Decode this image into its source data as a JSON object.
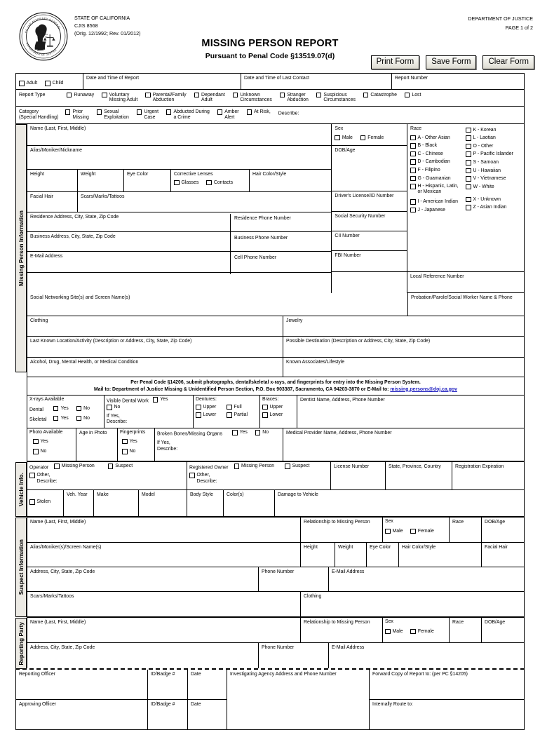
{
  "header": {
    "state": "STATE OF CALIFORNIA",
    "form_no": "CJIS 8568",
    "revision": "(Orig. 12/1992; Rev. 01/2012)",
    "department": "DEPARTMENT OF JUSTICE",
    "page": "PAGE 1 of 2",
    "title": "MISSING PERSON REPORT",
    "subtitle": "Pursuant to Penal Code §13519.07(d)",
    "buttons": {
      "print": "Print Form",
      "save": "Save Form",
      "clear": "Clear Form"
    }
  },
  "top": {
    "adult": "Adult",
    "child": "Child",
    "date_report": "Date and Time of Report",
    "date_last_contact": "Date and Time of Last Contact",
    "report_number": "Report Number",
    "report_type_label": "Report Type",
    "report_types": [
      "Runaway",
      "Voluntary\nMissing Adult",
      "Parental/Family\nAbduction",
      "Dependant\nAdult",
      "Unknown\nCircumstances",
      "Stranger\nAbduction",
      "Suspicious\nCircumstances",
      "Catastrophe",
      "Lost"
    ],
    "category_label": "Category\n(Special Handling)",
    "categories": [
      "Prior\nMissing",
      "Sexual\nExploitation",
      "Urgent\nCase",
      "Abducted During\na Crime",
      "Amber\nAlert"
    ],
    "at_risk": "At Risk,",
    "describe": "Describe:"
  },
  "missing": {
    "section_label": "Missing Person Information",
    "name": "Name (Last, First, Middle)",
    "sex": "Sex",
    "male": "Male",
    "female": "Female",
    "race_label": "Race",
    "alias": "Alias/Moniker/Nickname",
    "dob_age": "DOB/Age",
    "height": "Height",
    "weight": "Weight",
    "eye_color": "Eye Color",
    "corrective_lenses": "Corrective Lenses",
    "glasses": "Glasses",
    "contacts": "Contacts",
    "hair_color_style": "Hair Color/Style",
    "facial_hair": "Facial Hair",
    "scars": "Scars/Marks/Tattoos",
    "dl_number": "Driver's License/ID Number",
    "residence_address": "Residence Address, City, State, Zip Code",
    "residence_phone": "Residence Phone Number",
    "ssn": "Social Security Number",
    "business_address": "Business Address, City, State, Zip Code",
    "business_phone": "Business Phone Number",
    "cii_number": "CII Number",
    "email": "E-Mail Address",
    "cell_phone": "Cell Phone Number",
    "fbi_number": "FBI Number",
    "local_reference": "Local Reference Number",
    "social_networking": "Social Networking Site(s) and Screen Name(s)",
    "probation": "Probation/Parole/Social Worker Name & Phone",
    "clothing": "Clothing",
    "jewelry": "Jewelry",
    "last_known": "Last Known Location/Activity (Description or Address, City, State, Zip Code)",
    "possible_destination": "Possible Destination (Description or Address, City, State, Zip Code)",
    "alcohol": "Alcohol, Drug, Mental Health, or Medical Condition",
    "known_associates": "Known Associates/Lifestyle",
    "races_left": [
      "A - Other Asian",
      "B - Black",
      "C - Chinese",
      "D - Cambodian",
      "F - Filipino",
      "G - Guamanian",
      "H - Hispanic, Latin,\nor Mexican",
      "I - American Indian",
      "J - Japanese"
    ],
    "races_right": [
      "K - Korean",
      "L - Laotian",
      "O - Other",
      "P - Pacific Islander",
      "S - Samoan",
      "U - Hawaiian",
      "V - Vietnamese",
      "W - White",
      "X - Unknown",
      "Z - Asian Indian"
    ]
  },
  "notice": {
    "line1": "Per Penal Code §14206, submit photographs, dental/skeletal x-rays, and fingerprints for entry into the Missing Person System.",
    "line2_a": "Mail to: Department of Justice Missing & Unidentified Person Section, P.O. Box 903387, Sacramento, CA  94203-3870 or E-Mail to: ",
    "line2_email": "missing.persons@doj.ca.gov"
  },
  "dental": {
    "xrays_available": "X-rays Available",
    "dental": "Dental",
    "skeletal": "Skeletal",
    "yes": "Yes",
    "no": "No",
    "visible_dental_work": "Visible Dental Work",
    "if_yes_describe": "If Yes,\nDescribe:",
    "dentures": "Dentures:",
    "upper": "Upper",
    "lower": "Lower",
    "full": "Full",
    "partial": "Partial",
    "braces": "Braces:",
    "dentist": "Dentist Name, Address, Phone Number",
    "photo_available": "Photo Available",
    "age_in_photo": "Age in Photo",
    "fingerprints": "Fingerprints",
    "broken_bones": "Broken Bones/Missing Organs",
    "medical_provider": "Medical Provider Name, Address, Phone Number"
  },
  "vehicle": {
    "section_label": "Vehicle Info.",
    "operator": "Operator",
    "missing_person": "Missing Person",
    "suspect": "Suspect",
    "other_describe": "Other,\nDescribe:",
    "registered_owner": "Registered Owner",
    "license_number": "License Number",
    "state_province": "State, Province, Country",
    "registration_expiration": "Registration Expiration",
    "stolen": "Stolen",
    "veh_year": "Veh. Year",
    "make": "Make",
    "model": "Model",
    "body_style": "Body Style",
    "colors": "Color(s)",
    "damage": "Damage to Vehicle"
  },
  "suspect": {
    "section_label": "Suspect Information",
    "name": "Name (Last, First, Middle)",
    "relationship": "Relationship to Missing Person",
    "sex": "Sex",
    "male": "Male",
    "female": "Female",
    "race": "Race",
    "dob_age": "DOB/Age",
    "alias": "Alias/Moniker(s)/Screen Name(s)",
    "height": "Height",
    "weight": "Weight",
    "eye_color": "Eye Color",
    "hair_color_style": "Hair Color/Style",
    "facial_hair": "Facial Hair",
    "address": "Address, City, State, Zip Code",
    "phone": "Phone Number",
    "email": "E-Mail Address",
    "scars": "Scars/Marks/Tattoos",
    "clothing": "Clothing"
  },
  "reporting": {
    "section_label": "Reporting Party",
    "name": "Name (Last, First, Middle)",
    "relationship": "Relationship to Missing Person",
    "sex": "Sex",
    "male": "Male",
    "female": "Female",
    "race": "Race",
    "dob_age": "DOB/Age",
    "address": "Address, City, State, Zip Code",
    "phone": "Phone Number",
    "email": "E-Mail Address"
  },
  "officer": {
    "reporting_officer": "Reporting Officer",
    "id_badge": "ID/Badge #",
    "date": "Date",
    "investigating_agency": "Investigating Agency Address and Phone Number",
    "forward_copy": "Forward Copy of Report to: (per PC §14205)",
    "approving_officer": "Approving Officer",
    "internally_route": "Internally Route to:"
  }
}
